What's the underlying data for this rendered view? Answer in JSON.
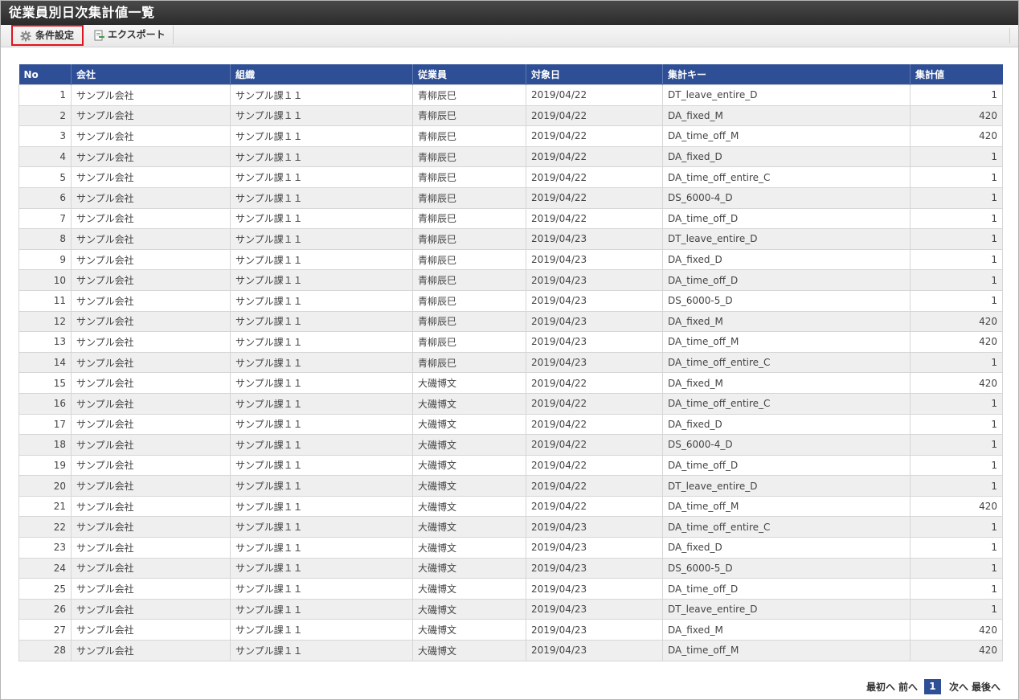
{
  "window": {
    "title": "従業員別日次集計値一覧"
  },
  "toolbar": {
    "condition_label": "条件設定",
    "export_label": "エクスポート"
  },
  "table": {
    "columns": [
      "No",
      "会社",
      "組織",
      "従業員",
      "対象日",
      "集計キー",
      "集計値"
    ],
    "rows": [
      [
        "1",
        "サンプル会社",
        "サンプル課１１",
        "青柳辰巳",
        "2019/04/22",
        "DT_leave_entire_D",
        "1"
      ],
      [
        "2",
        "サンプル会社",
        "サンプル課１１",
        "青柳辰巳",
        "2019/04/22",
        "DA_fixed_M",
        "420"
      ],
      [
        "3",
        "サンプル会社",
        "サンプル課１１",
        "青柳辰巳",
        "2019/04/22",
        "DA_time_off_M",
        "420"
      ],
      [
        "4",
        "サンプル会社",
        "サンプル課１１",
        "青柳辰巳",
        "2019/04/22",
        "DA_fixed_D",
        "1"
      ],
      [
        "5",
        "サンプル会社",
        "サンプル課１１",
        "青柳辰巳",
        "2019/04/22",
        "DA_time_off_entire_C",
        "1"
      ],
      [
        "6",
        "サンプル会社",
        "サンプル課１１",
        "青柳辰巳",
        "2019/04/22",
        "DS_6000-4_D",
        "1"
      ],
      [
        "7",
        "サンプル会社",
        "サンプル課１１",
        "青柳辰巳",
        "2019/04/22",
        "DA_time_off_D",
        "1"
      ],
      [
        "8",
        "サンプル会社",
        "サンプル課１１",
        "青柳辰巳",
        "2019/04/23",
        "DT_leave_entire_D",
        "1"
      ],
      [
        "9",
        "サンプル会社",
        "サンプル課１１",
        "青柳辰巳",
        "2019/04/23",
        "DA_fixed_D",
        "1"
      ],
      [
        "10",
        "サンプル会社",
        "サンプル課１１",
        "青柳辰巳",
        "2019/04/23",
        "DA_time_off_D",
        "1"
      ],
      [
        "11",
        "サンプル会社",
        "サンプル課１１",
        "青柳辰巳",
        "2019/04/23",
        "DS_6000-5_D",
        "1"
      ],
      [
        "12",
        "サンプル会社",
        "サンプル課１１",
        "青柳辰巳",
        "2019/04/23",
        "DA_fixed_M",
        "420"
      ],
      [
        "13",
        "サンプル会社",
        "サンプル課１１",
        "青柳辰巳",
        "2019/04/23",
        "DA_time_off_M",
        "420"
      ],
      [
        "14",
        "サンプル会社",
        "サンプル課１１",
        "青柳辰巳",
        "2019/04/23",
        "DA_time_off_entire_C",
        "1"
      ],
      [
        "15",
        "サンプル会社",
        "サンプル課１１",
        "大磯博文",
        "2019/04/22",
        "DA_fixed_M",
        "420"
      ],
      [
        "16",
        "サンプル会社",
        "サンプル課１１",
        "大磯博文",
        "2019/04/22",
        "DA_time_off_entire_C",
        "1"
      ],
      [
        "17",
        "サンプル会社",
        "サンプル課１１",
        "大磯博文",
        "2019/04/22",
        "DA_fixed_D",
        "1"
      ],
      [
        "18",
        "サンプル会社",
        "サンプル課１１",
        "大磯博文",
        "2019/04/22",
        "DS_6000-4_D",
        "1"
      ],
      [
        "19",
        "サンプル会社",
        "サンプル課１１",
        "大磯博文",
        "2019/04/22",
        "DA_time_off_D",
        "1"
      ],
      [
        "20",
        "サンプル会社",
        "サンプル課１１",
        "大磯博文",
        "2019/04/22",
        "DT_leave_entire_D",
        "1"
      ],
      [
        "21",
        "サンプル会社",
        "サンプル課１１",
        "大磯博文",
        "2019/04/22",
        "DA_time_off_M",
        "420"
      ],
      [
        "22",
        "サンプル会社",
        "サンプル課１１",
        "大磯博文",
        "2019/04/23",
        "DA_time_off_entire_C",
        "1"
      ],
      [
        "23",
        "サンプル会社",
        "サンプル課１１",
        "大磯博文",
        "2019/04/23",
        "DA_fixed_D",
        "1"
      ],
      [
        "24",
        "サンプル会社",
        "サンプル課１１",
        "大磯博文",
        "2019/04/23",
        "DS_6000-5_D",
        "1"
      ],
      [
        "25",
        "サンプル会社",
        "サンプル課１１",
        "大磯博文",
        "2019/04/23",
        "DA_time_off_D",
        "1"
      ],
      [
        "26",
        "サンプル会社",
        "サンプル課１１",
        "大磯博文",
        "2019/04/23",
        "DT_leave_entire_D",
        "1"
      ],
      [
        "27",
        "サンプル会社",
        "サンプル課１１",
        "大磯博文",
        "2019/04/23",
        "DA_fixed_M",
        "420"
      ],
      [
        "28",
        "サンプル会社",
        "サンプル課１１",
        "大磯博文",
        "2019/04/23",
        "DA_time_off_M",
        "420"
      ]
    ]
  },
  "pager": {
    "first": "最初へ",
    "prev": "前へ",
    "current": "1",
    "next": "次へ",
    "last": "最後へ"
  },
  "icons": {
    "condition": "gear-icon",
    "export": "export-document-icon"
  },
  "colors": {
    "header": "#2e4f95",
    "highlight": "#e0141e",
    "titlebar": "#333333"
  }
}
